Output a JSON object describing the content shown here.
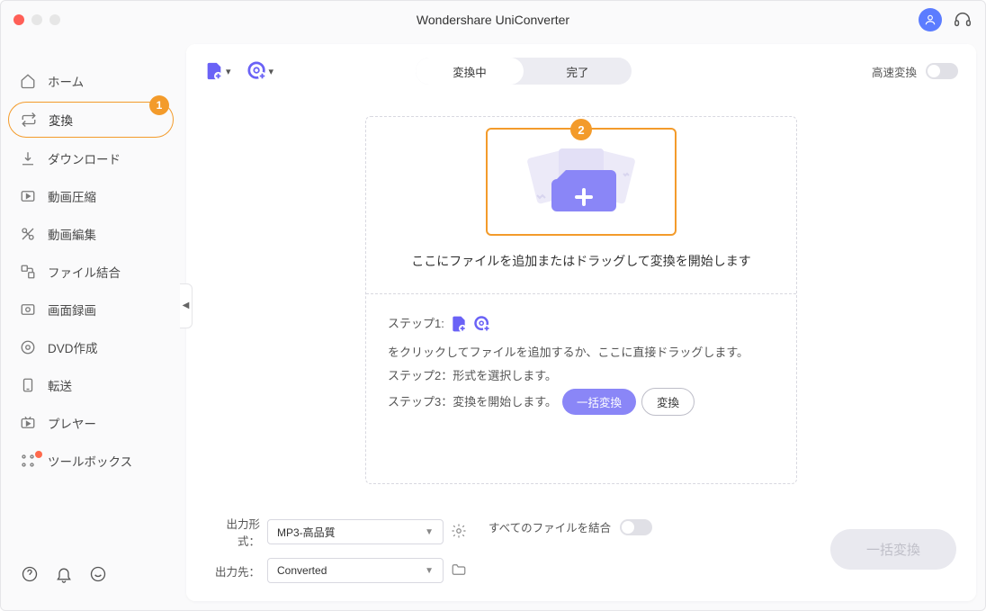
{
  "title": "Wondershare UniConverter",
  "sidebar": {
    "items": [
      {
        "label": "ホーム",
        "icon": "home-icon"
      },
      {
        "label": "変換",
        "icon": "convert-icon",
        "active": true,
        "badge": "1"
      },
      {
        "label": "ダウンロード",
        "icon": "download-icon"
      },
      {
        "label": "動画圧縮",
        "icon": "compress-icon"
      },
      {
        "label": "動画編集",
        "icon": "edit-icon"
      },
      {
        "label": "ファイル結合",
        "icon": "merge-icon"
      },
      {
        "label": "画面録画",
        "icon": "record-icon"
      },
      {
        "label": "DVD作成",
        "icon": "dvd-icon"
      },
      {
        "label": "転送",
        "icon": "transfer-icon"
      },
      {
        "label": "プレヤー",
        "icon": "player-icon"
      },
      {
        "label": "ツールボックス",
        "icon": "toolbox-icon",
        "dot": true
      }
    ]
  },
  "toolbar": {
    "seg": {
      "active": "変換中",
      "done": "完了"
    },
    "fast_label": "高速変換"
  },
  "dropzone": {
    "badge": "2",
    "text": "ここにファイルを追加またはドラッグして変換を開始します",
    "step1_prefix": "ステップ1:",
    "step1_suffix": "をクリックしてファイルを追加するか、ここに直接ドラッグします。",
    "step2": "ステップ2：形式を選択します。",
    "step3": "ステップ3：変換を開始します。",
    "batch_btn": "一括変換",
    "convert_btn": "変換"
  },
  "bottom": {
    "format_label": "出力形式：",
    "format_value": "MP3-高品質",
    "output_label": "出力先：",
    "output_value": "Converted",
    "merge_label": "すべてのファイルを結合",
    "big_btn": "一括変換"
  }
}
